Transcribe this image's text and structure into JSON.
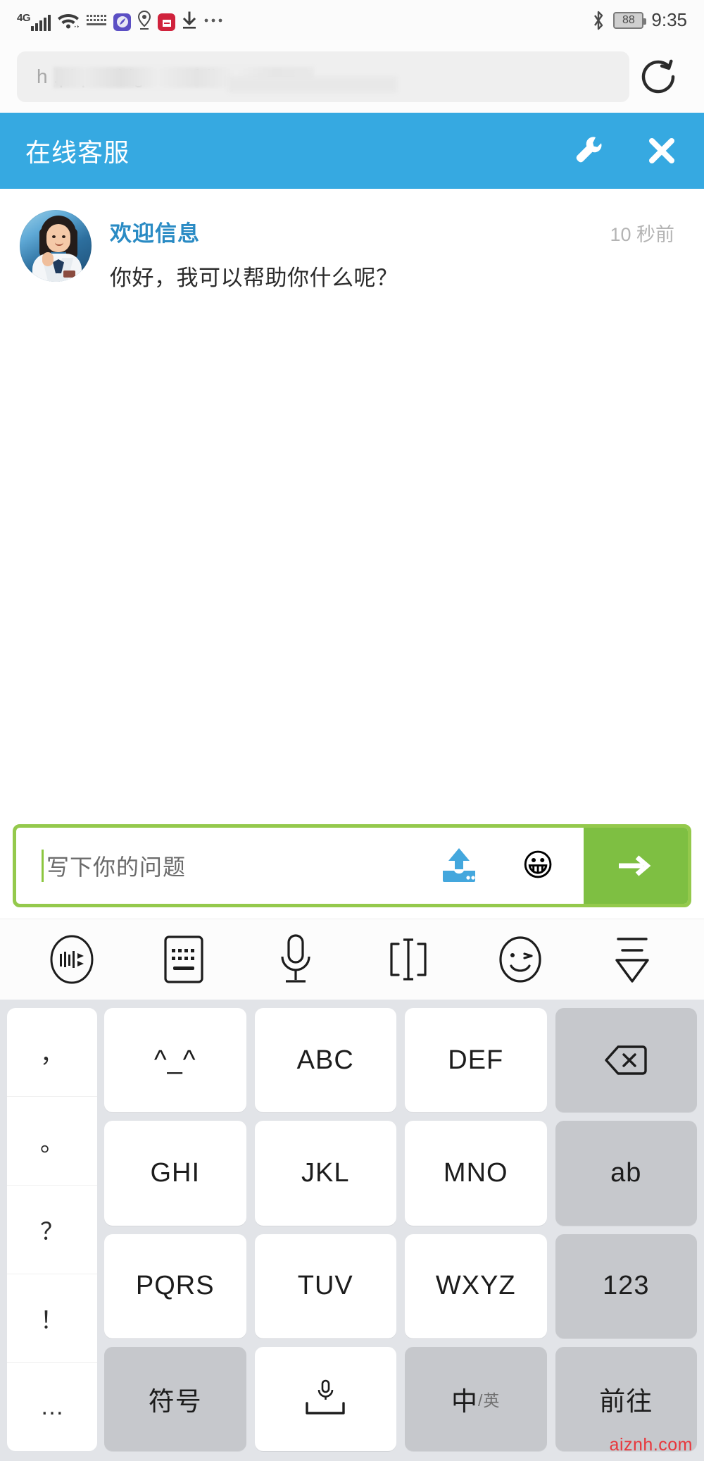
{
  "statusbar": {
    "network_label": "4G",
    "battery_percent": "88",
    "time": "9:35",
    "icons": [
      "signal-icon",
      "wifi-icon",
      "keyboard-icon",
      "app-purple-icon",
      "location-icon",
      "shopping-bag-icon",
      "download-icon",
      "more-dots-icon",
      "bluetooth-icon",
      "battery-icon"
    ]
  },
  "browser": {
    "url_visible_text": "h                          .php?widget-mobile",
    "reload_label": "reload-icon"
  },
  "chat_header": {
    "title": "在线客服",
    "settings_label": "wrench-icon",
    "close_label": "close-icon",
    "background_color": "#36a9e1"
  },
  "message": {
    "sender": "欢迎信息",
    "time": "10 秒前",
    "text": "你好，我可以帮助你什么呢？",
    "avatar_label": "agent-avatar"
  },
  "input_bar": {
    "placeholder": "写下你的问题",
    "value": "",
    "upload_label": "upload-icon",
    "emoji_label": "😀",
    "send_label": "send-arrow-icon",
    "border_color": "#94c94c",
    "send_color": "#7ebf42"
  },
  "ime_toolbar": {
    "items": [
      {
        "name": "iflytek-logo-icon",
        "label": "讯飞"
      },
      {
        "name": "keyboard-icon",
        "label": "键盘"
      },
      {
        "name": "microphone-icon",
        "label": "语音"
      },
      {
        "name": "text-cursor-icon",
        "label": "编辑"
      },
      {
        "name": "smiley-icon",
        "label": "表情"
      },
      {
        "name": "collapse-keyboard-icon",
        "label": "收起"
      }
    ]
  },
  "keyboard": {
    "punctuation_column": [
      "，",
      "。",
      "？",
      "！",
      "…"
    ],
    "rows": [
      [
        {
          "label": "^_^",
          "type": "normal",
          "name": "key-kaomoji"
        },
        {
          "label": "ABC",
          "type": "normal",
          "name": "key-abc"
        },
        {
          "label": "DEF",
          "type": "normal",
          "name": "key-def"
        },
        {
          "label": "",
          "type": "fn",
          "name": "key-backspace",
          "icon": "backspace-icon"
        }
      ],
      [
        {
          "label": "GHI",
          "type": "normal",
          "name": "key-ghi"
        },
        {
          "label": "JKL",
          "type": "normal",
          "name": "key-jkl"
        },
        {
          "label": "MNO",
          "type": "normal",
          "name": "key-mno"
        },
        {
          "label": "ab",
          "type": "fn",
          "name": "key-ab"
        }
      ],
      [
        {
          "label": "PQRS",
          "type": "normal",
          "name": "key-pqrs"
        },
        {
          "label": "TUV",
          "type": "normal",
          "name": "key-tuv"
        },
        {
          "label": "WXYZ",
          "type": "normal",
          "name": "key-wxyz"
        },
        {
          "label": "123",
          "type": "fn",
          "name": "key-123"
        }
      ],
      [
        {
          "label": "符号",
          "type": "fn",
          "name": "key-symbols"
        },
        {
          "label": "",
          "type": "normal",
          "name": "key-space",
          "icon": "space-mic-icon"
        },
        {
          "label": "中",
          "sub": "/英",
          "type": "fn",
          "name": "key-lang-toggle"
        },
        {
          "label": "前往",
          "type": "fn",
          "name": "key-go"
        }
      ]
    ]
  },
  "watermark": "aiznh.com"
}
